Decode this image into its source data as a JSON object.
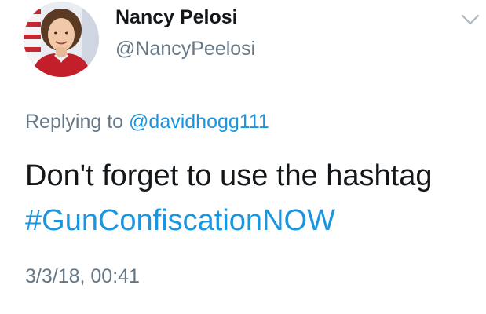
{
  "tweet": {
    "author": {
      "display_name": "Nancy Pelosi",
      "handle": "@NancyPeelosi",
      "avatar_icon": "profile-photo"
    },
    "menu_icon": "chevron-down-icon",
    "reply_prefix": "Replying to",
    "reply_to": "@davidhogg111",
    "text_line1": "Don't forget to use the hashtag",
    "hashtag": "#GunConfiscationNOW",
    "timestamp": "3/3/18, 00:41"
  },
  "colors": {
    "text": "#14171a",
    "secondary": "#657786",
    "link": "#1b95e0",
    "background": "#ffffff"
  }
}
